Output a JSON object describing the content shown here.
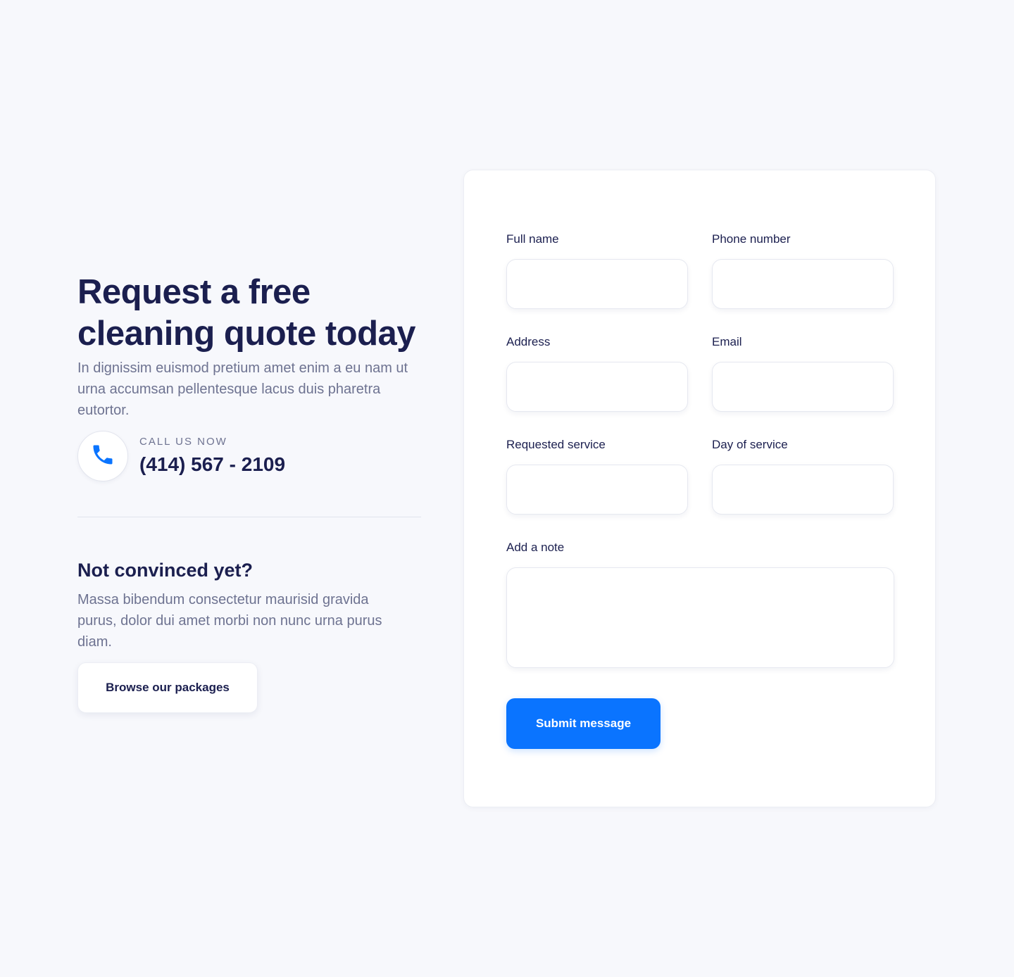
{
  "hero": {
    "title": "Request a free cleaning quote today",
    "subtitle": "In dignissim euismod pretium amet enim a eu nam ut urna accumsan pellentesque lacus duis pharetra eutortor."
  },
  "contact": {
    "icon": "phone-icon",
    "label": "CALL US NOW",
    "phone": "(414) 567 - 2109"
  },
  "secondary": {
    "heading": "Not convinced yet?",
    "text": "Massa bibendum consectetur maurisid gravida purus, dolor dui amet morbi non nunc urna purus diam.",
    "button_label": "Browse our packages"
  },
  "form": {
    "full_name_label": "Full name",
    "phone_label": "Phone number",
    "address_label": "Address",
    "email_label": "Email",
    "service_label": "Requested service",
    "day_label": "Day of service",
    "note_label": "Add a note",
    "submit_label": "Submit message"
  },
  "colors": {
    "accent": "#0a74ff",
    "heading": "#1b1f4f",
    "body_text": "#6e7391",
    "background": "#f7f8fc"
  }
}
